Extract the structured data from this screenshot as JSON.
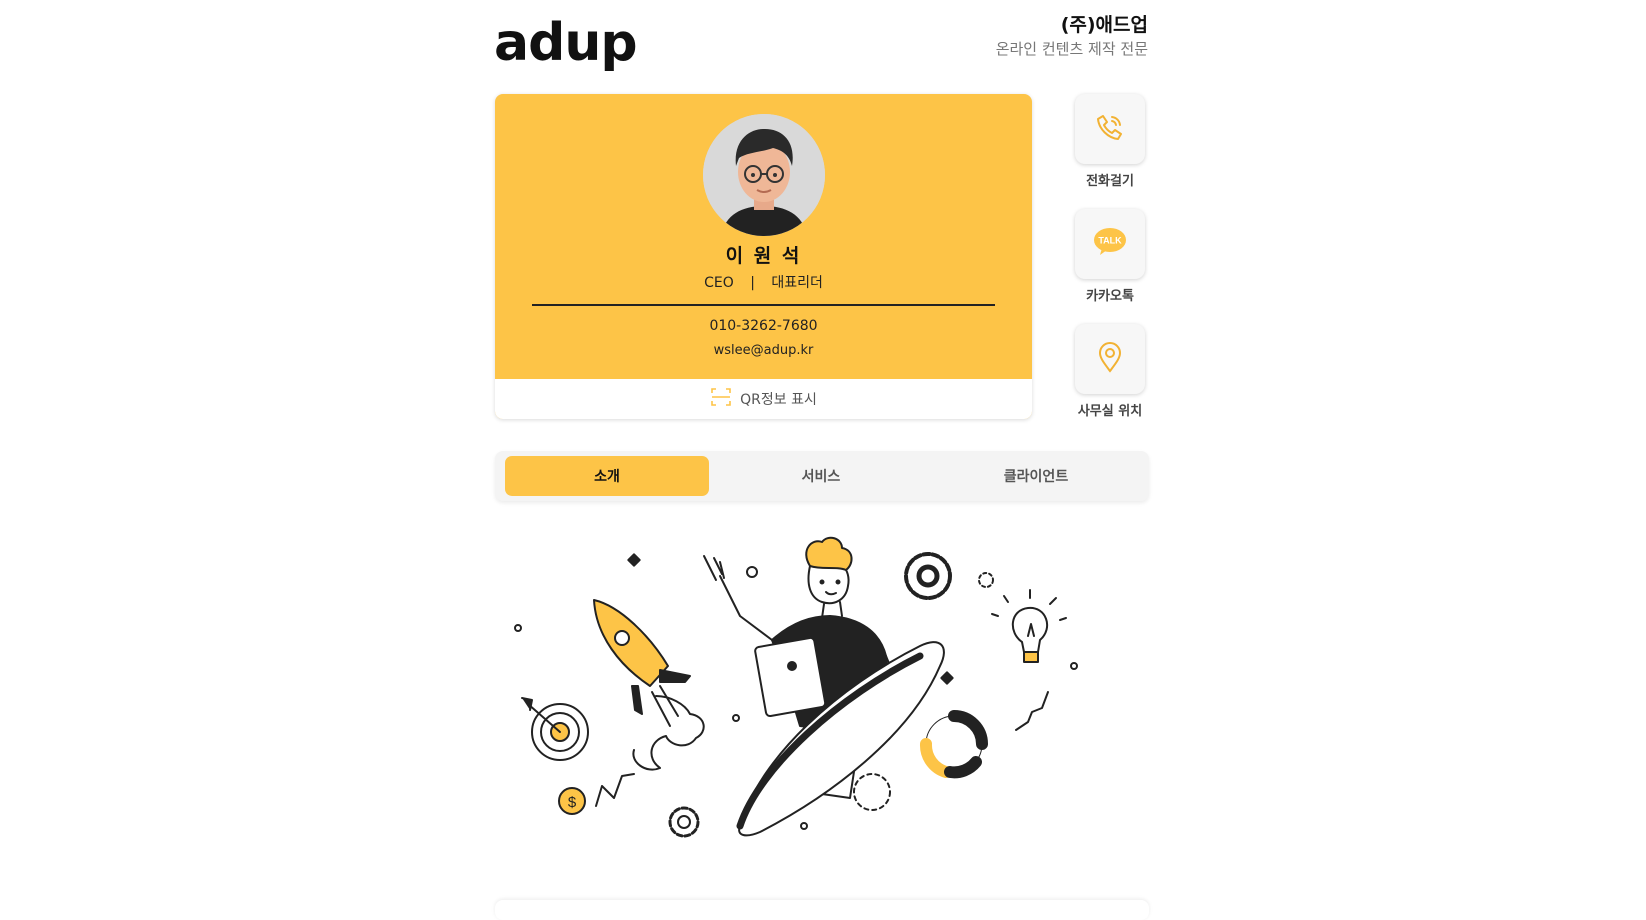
{
  "header": {
    "logo_text": "adup",
    "company_name": "(주)애드업",
    "company_tagline": "온라인 컨텐츠 제작 전문"
  },
  "profile": {
    "name": "이 원 석",
    "title": "CEO",
    "separator": "|",
    "position": "대표리더",
    "phone": "010-3262-7680",
    "email": "wslee@adup.kr",
    "qr_label": "QR정보 표시"
  },
  "actions": [
    {
      "label": "전화걸기",
      "icon": "phone-icon"
    },
    {
      "label": "카카오톡",
      "icon": "kakao-talk-icon",
      "icon_text": "TALK"
    },
    {
      "label": "사무실 위치",
      "icon": "location-pin-icon"
    }
  ],
  "tabs": [
    {
      "label": "소개",
      "active": true
    },
    {
      "label": "서비스",
      "active": false
    },
    {
      "label": "클라이언트",
      "active": false
    }
  ],
  "colors": {
    "accent": "#fdc447",
    "text_dark": "#111111",
    "muted": "#777777"
  }
}
